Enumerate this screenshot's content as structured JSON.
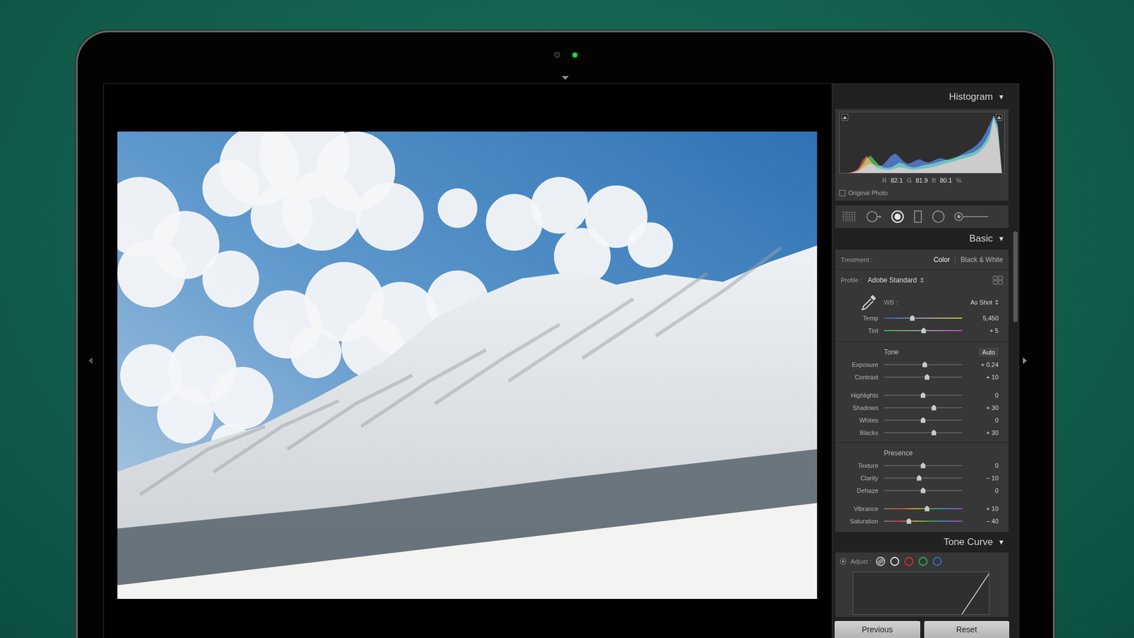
{
  "histogram": {
    "title": "Histogram",
    "toggle": "▼",
    "readout": [
      {
        "label": "R",
        "value": "82.1"
      },
      {
        "label": "G",
        "value": "81.9"
      },
      {
        "label": "B",
        "value": "80.1"
      }
    ],
    "unit": "%",
    "original_photo": {
      "label": "Original Photo",
      "checked": false
    },
    "series": [
      {
        "color": "#e0302a",
        "values": [
          0,
          0,
          1,
          3,
          8,
          22,
          30,
          20,
          12,
          8,
          6,
          5,
          6,
          8,
          10,
          9,
          7,
          6,
          6,
          7,
          8,
          9,
          10,
          12,
          14,
          16,
          18,
          20,
          22,
          24,
          26,
          28,
          30,
          34,
          40,
          48,
          60,
          95,
          70,
          0
        ]
      },
      {
        "color": "#35c43a",
        "values": [
          0,
          0,
          0,
          2,
          5,
          14,
          26,
          30,
          22,
          14,
          10,
          9,
          10,
          14,
          18,
          16,
          12,
          10,
          10,
          12,
          14,
          15,
          16,
          18,
          20,
          22,
          24,
          26,
          28,
          30,
          32,
          34,
          36,
          40,
          46,
          56,
          70,
          100,
          80,
          0
        ]
      },
      {
        "color": "#3a6ee0",
        "values": [
          0,
          0,
          0,
          1,
          3,
          8,
          14,
          16,
          14,
          12,
          14,
          22,
          30,
          34,
          28,
          20,
          16,
          18,
          22,
          24,
          20,
          18,
          20,
          24,
          26,
          24,
          22,
          24,
          28,
          32,
          36,
          40,
          44,
          50,
          58,
          70,
          85,
          100,
          85,
          0
        ]
      }
    ]
  },
  "tools": [
    {
      "kind": "crop",
      "selected": false
    },
    {
      "kind": "spot",
      "selected": false
    },
    {
      "kind": "redeye",
      "selected": true
    },
    {
      "kind": "gradient",
      "selected": false
    },
    {
      "kind": "radial",
      "selected": false
    },
    {
      "kind": "brush",
      "selected": false
    }
  ],
  "basic": {
    "title": "Basic",
    "toggle": "▼",
    "treatment": {
      "label": "Treatment :",
      "options": [
        {
          "label": "Color",
          "selected": true
        },
        {
          "label": "Black & White",
          "selected": false
        }
      ]
    },
    "profile": {
      "label": "Profile :",
      "value": "Adobe Standard"
    },
    "wb": {
      "label": "WB :",
      "value": "As Shot",
      "sliders": [
        {
          "label": "Temp",
          "value": "5,450",
          "level": 0.36,
          "kind": "temp"
        },
        {
          "label": "Tint",
          "value": "+ 5",
          "level": 0.51,
          "kind": "tint"
        }
      ]
    },
    "tone": {
      "title": "Tone",
      "auto": "Auto",
      "clusters": [
        [
          {
            "label": "Exposure",
            "value": "+ 0.24",
            "level": 0.52,
            "kind": "plain"
          },
          {
            "label": "Contrast",
            "value": "+ 10",
            "level": 0.55,
            "kind": "plain"
          }
        ],
        [
          {
            "label": "Highlights",
            "value": "0",
            "level": 0.5,
            "kind": "plain"
          },
          {
            "label": "Shadows",
            "value": "+ 30",
            "level": 0.64,
            "kind": "plain"
          },
          {
            "label": "Whites",
            "value": "0",
            "level": 0.5,
            "kind": "plain"
          },
          {
            "label": "Blacks",
            "value": "+ 30",
            "level": 0.64,
            "kind": "plain"
          }
        ]
      ]
    },
    "presence": {
      "title": "Presence",
      "clusters": [
        [
          {
            "label": "Texture",
            "value": "0",
            "level": 0.5,
            "kind": "plain"
          },
          {
            "label": "Clarity",
            "value": "− 10",
            "level": 0.45,
            "kind": "plain"
          },
          {
            "label": "Dehaze",
            "value": "0",
            "level": 0.5,
            "kind": "plain"
          }
        ],
        [
          {
            "label": "Vibrance",
            "value": "+ 10",
            "level": 0.55,
            "kind": "rainbow"
          },
          {
            "label": "Saturation",
            "value": "− 40",
            "level": 0.32,
            "kind": "rainbow"
          }
        ]
      ]
    }
  },
  "tone_curve": {
    "title": "Tone Curve",
    "toggle": "▼",
    "adjust_label": "Adjust :",
    "channels": [
      {
        "kind": "parametric",
        "selected": true,
        "color": "#d0d0d0"
      },
      {
        "kind": "point",
        "selected": false,
        "color": "#e8e8e8"
      },
      {
        "kind": "point",
        "selected": false,
        "color": "#e03030"
      },
      {
        "kind": "point",
        "selected": false,
        "color": "#30b040"
      },
      {
        "kind": "point",
        "selected": false,
        "color": "#3070e0"
      }
    ],
    "curve": [
      [
        0,
        0
      ],
      [
        1,
        1
      ]
    ]
  },
  "buttons": [
    "Previous",
    "Reset"
  ]
}
